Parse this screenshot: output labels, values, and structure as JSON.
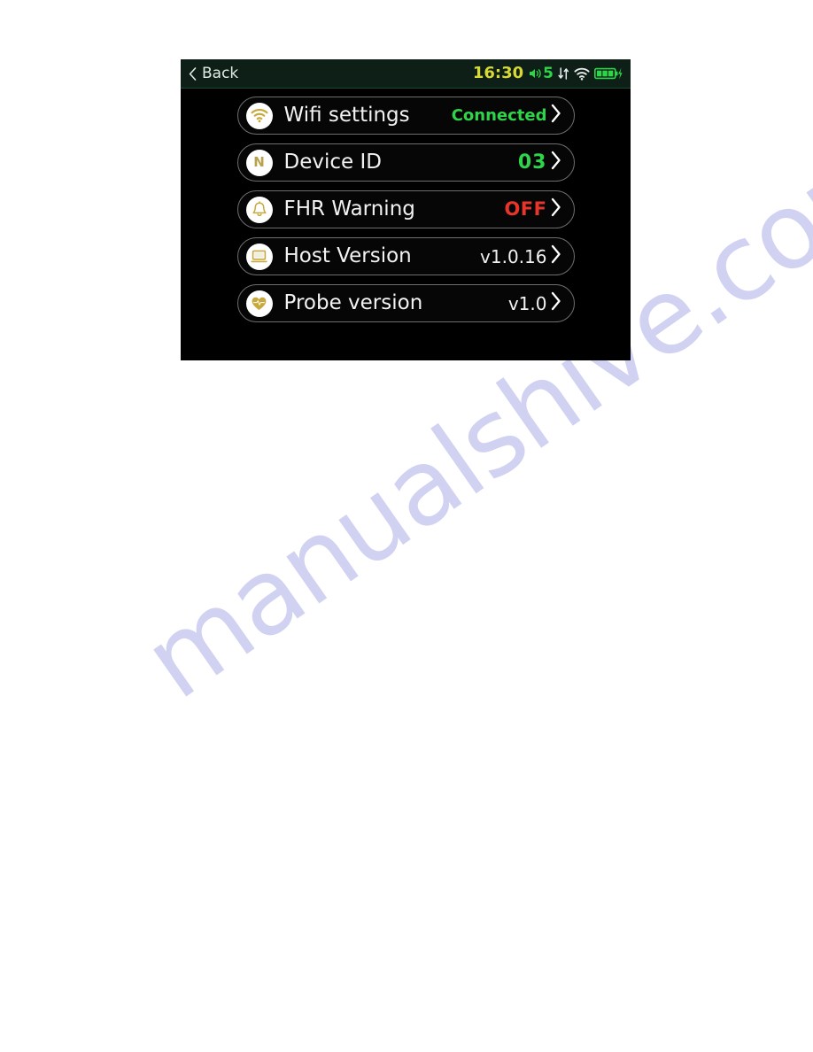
{
  "watermark": {
    "text": "manualshive.com"
  },
  "device": {
    "status_bar": {
      "back_label": "Back",
      "back_icon": "chevron-left-icon",
      "clock": "16:30",
      "volume_icon": "speaker-icon",
      "volume_level": "5",
      "transfer_icon": "data-transfer-icon",
      "wifi_icon": "wifi-icon",
      "battery_icon": "battery-charging-icon",
      "battery_bars": 3,
      "accent_time": "#d8d936",
      "accent_status": "#2fd44a",
      "background": "#0d1f16"
    },
    "menu": {
      "rows": [
        {
          "icon": "wifi-icon",
          "label": "Wifi settings",
          "value": "Connected",
          "value_color": "#2fd44a",
          "chevron": "chevron-right-icon"
        },
        {
          "icon": "letter-n-icon",
          "label": "Device ID",
          "value": "03",
          "value_color": "#2fd44a",
          "chevron": "chevron-right-icon"
        },
        {
          "icon": "bell-icon",
          "label": "FHR Warning",
          "value": "OFF",
          "value_color": "#e8352c",
          "chevron": "chevron-right-icon"
        },
        {
          "icon": "laptop-icon",
          "label": "Host Version",
          "value": "v1.0.16",
          "value_color": "#f2f2f2",
          "chevron": "chevron-right-icon"
        },
        {
          "icon": "heart-icon",
          "label": "Probe version",
          "value": "v1.0",
          "value_color": "#f2f2f2",
          "chevron": "chevron-right-icon"
        }
      ]
    }
  }
}
